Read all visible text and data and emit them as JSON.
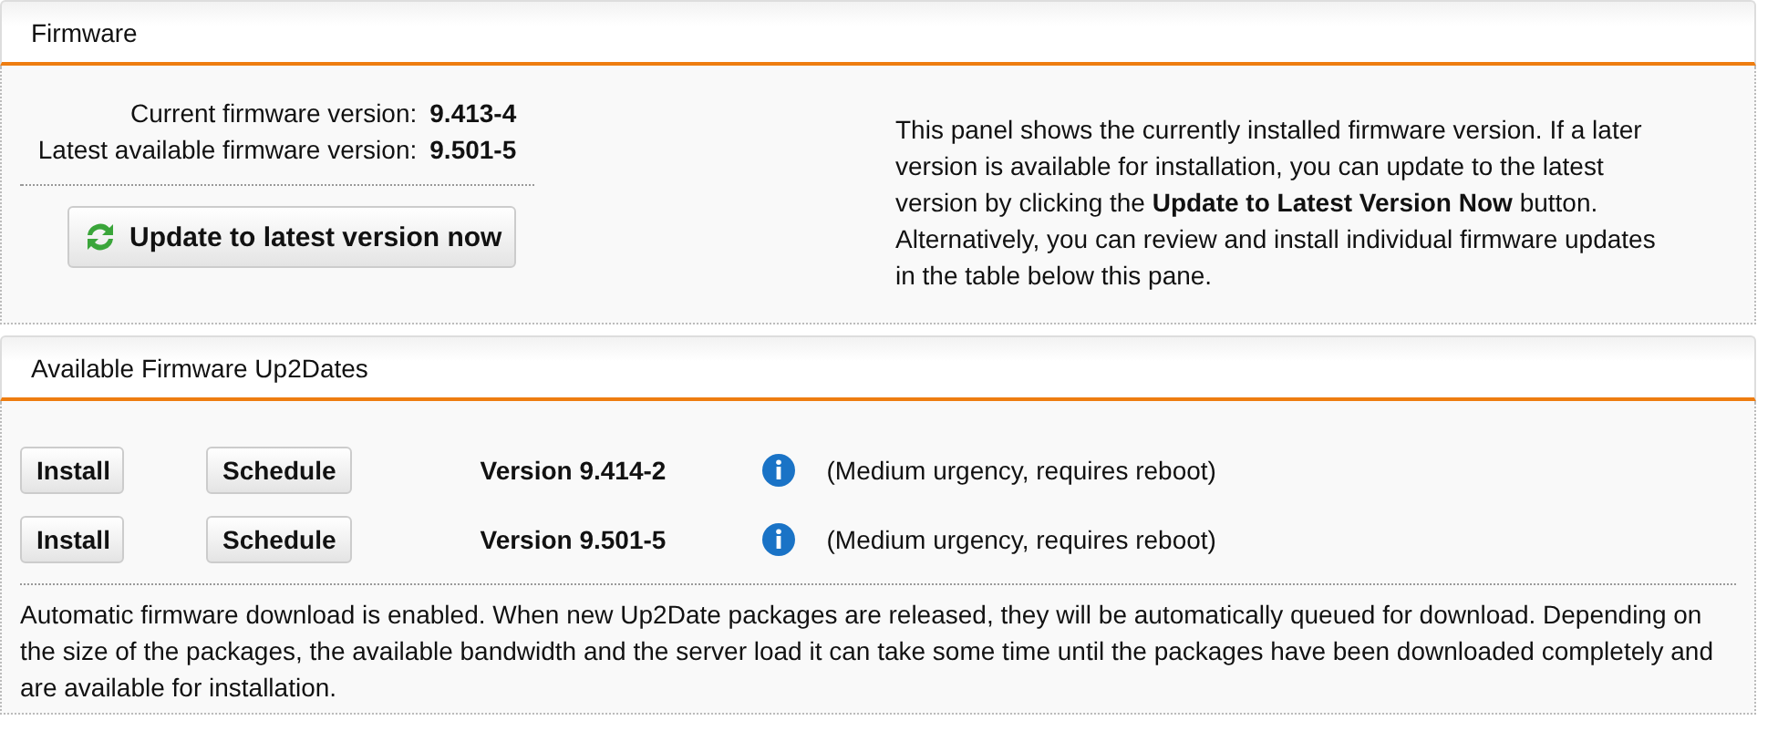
{
  "firmware": {
    "title": "Firmware",
    "info": [
      {
        "label": "Current firmware version:",
        "value": "9.413-4"
      },
      {
        "label": "Latest available firmware version:",
        "value": "9.501-5"
      }
    ],
    "update_button": "Update to latest version now",
    "description": "This panel shows the currently installed firmware version. If a later version is available for installation, you can update to the latest version by clicking the **Update to Latest Version Now** button. Alternatively, you can review and install individual firmware updates in the table below this pane."
  },
  "up2dates": {
    "title": "Available Firmware Up2Dates",
    "rows": [
      {
        "install": "Install",
        "schedule": "Schedule",
        "version": "Version 9.414-2",
        "note": "(Medium urgency, requires reboot)"
      },
      {
        "install": "Install",
        "schedule": "Schedule",
        "version": "Version 9.501-5",
        "note": "(Medium urgency, requires reboot)"
      }
    ],
    "footer": "Automatic firmware download is enabled. When new Up2Date packages are released, they will be automatically queued for download. Depending on the size of the packages, the available bandwidth and the server load it can take some time until the packages have been downloaded completely and are available for installation."
  }
}
